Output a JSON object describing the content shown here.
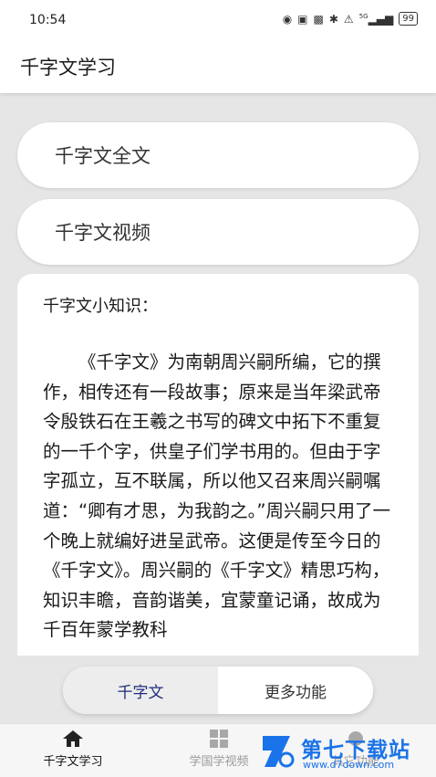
{
  "status_bar": {
    "time": "10:54",
    "icons": [
      "hd-icon",
      "nfc-icon",
      "vibrate-icon",
      "bluetooth-icon",
      "mute-icon",
      "signal-icon"
    ],
    "signal_label": "5G",
    "battery": "99"
  },
  "app_bar": {
    "title": "千字文学习"
  },
  "buttons": {
    "full_text": "千字文全文",
    "video": "千字文视频"
  },
  "card": {
    "heading": "千字文小知识：",
    "body": "《千字文》为南朝周兴嗣所编，它的撰作，相传还有一段故事；原来是当年梁武帝令殷铁石在王羲之书写的碑文中拓下不重复的一千个字，供皇子们学书用的。但由于字字孤立，互不联属，所以他又召来周兴嗣嘱道：“卿有才思，为我韵之。”周兴嗣只用了一个晚上就编好进呈武帝。这便是传至今日的《千字文》。周兴嗣的《千字文》精思巧构，知识丰瞻，音韵谐美，宜蒙童记诵，故成为千百年蒙学教科"
  },
  "segmented": {
    "active": "千字文",
    "inactive": "更多功能"
  },
  "bottom_nav": [
    {
      "label": "千字文学习",
      "icon": "home-icon"
    },
    {
      "label": "学国学视频",
      "icon": "grid-icon"
    },
    {
      "label": "其它功能",
      "icon": "more-icon"
    }
  ],
  "watermark": {
    "text": "第七下载站",
    "url": "www.d7down.com"
  },
  "colors": {
    "accent": "#1f2d7a",
    "watermark": "#1a73e8",
    "background": "#e6e6e6"
  }
}
